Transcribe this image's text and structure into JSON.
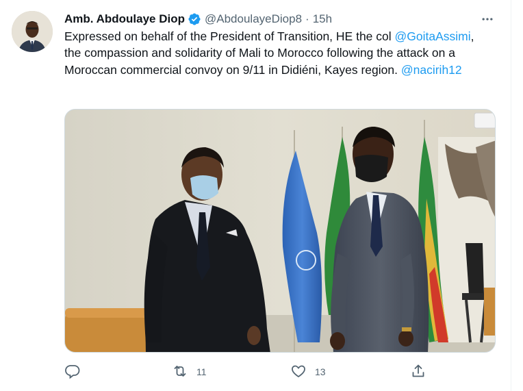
{
  "tweet": {
    "author": {
      "name": "Amb. Abdoulaye Diop",
      "handle": "@AbdoulayeDiop8",
      "verified_icon": "verified-badge-icon",
      "avatar_icon": "avatar"
    },
    "separator": "·",
    "time": "15h",
    "text": {
      "part1": "Expressed on behalf of the President of Transition, HE the col ",
      "mention1": "@GoitaAssimi",
      "part2": ", the compassion and solidarity of Mali to Morocco following the attack on a Moroccan commercial convoy on 9/11 in Didiéni, Kayes region. ",
      "mention2": "@nacirih12"
    },
    "actions": {
      "reply_count": "",
      "retweet_count": "11",
      "like_count": "13",
      "share_count": ""
    }
  },
  "colors": {
    "accent": "#1d9bf0",
    "text": "#0f1419",
    "secondary": "#536471"
  }
}
